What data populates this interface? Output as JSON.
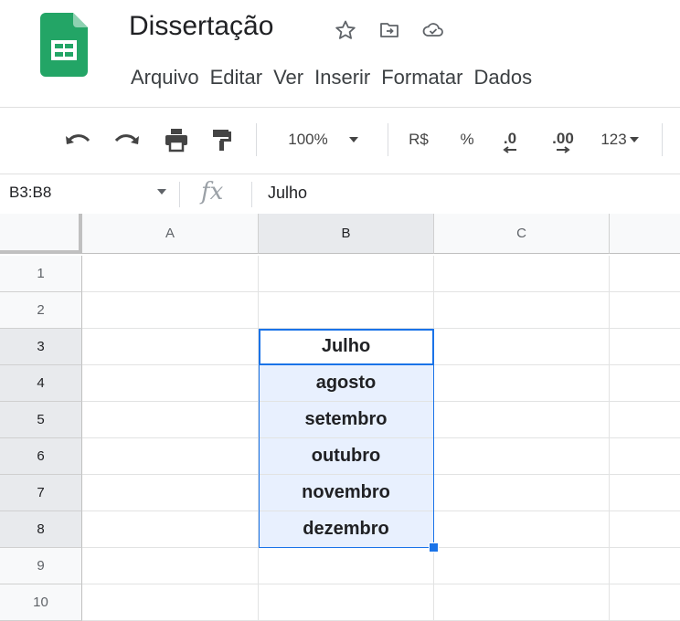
{
  "document": {
    "title": "Dissertação"
  },
  "menu": [
    "Arquivo",
    "Editar",
    "Ver",
    "Inserir",
    "Formatar",
    "Dados"
  ],
  "toolbar": {
    "zoom": "100%",
    "currency": "R$",
    "percent": "%",
    "dec_decrease": ".0",
    "dec_increase": ".00",
    "more_formats": "123"
  },
  "formula_bar": {
    "name_box": "B3:B8",
    "fx": "fx",
    "value": "Julho"
  },
  "grid": {
    "columns": [
      "A",
      "B",
      "C"
    ],
    "rows": [
      "1",
      "2",
      "3",
      "4",
      "5",
      "6",
      "7",
      "8",
      "9",
      "10"
    ],
    "b_values": [
      "",
      "",
      "Julho",
      "agosto",
      "setembro",
      "outubro",
      "novembro",
      "dezembro",
      "",
      ""
    ]
  },
  "colors": {
    "brand_green": "#0f9d58",
    "selection_blue": "#1a73e8",
    "selection_fill": "#e8f0fe"
  }
}
